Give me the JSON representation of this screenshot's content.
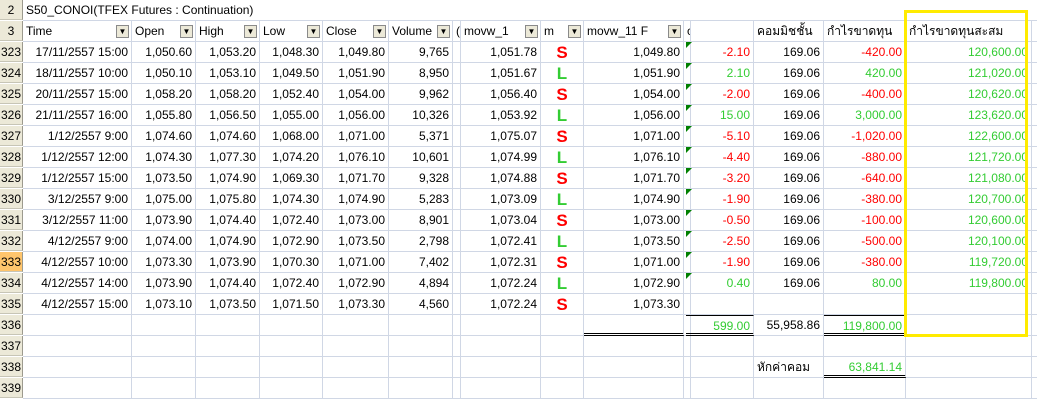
{
  "title_row": {
    "row": "2",
    "text": "S50_CONOI(TFEX Futures : Continuation)"
  },
  "header_row": {
    "row": "3",
    "time": "Time",
    "open": "Open",
    "high": "High",
    "low": "Low",
    "close": "Close",
    "volume": "Volume",
    "g": "(",
    "movw1": "movw_1",
    "m": "m",
    "movw11": "movw_11 F",
    "ce": "ce",
    "commission": "คอมมิชชั้น",
    "profit": "กำไรขาดทุน",
    "cumulative": "กำไรขาดทุนสะสม"
  },
  "rows": [
    {
      "row": "323",
      "time": "17/11/2557 15:00",
      "open": "1,050.60",
      "high": "1,053.20",
      "low": "1,048.30",
      "close": "1,049.80",
      "volume": "9,765",
      "movw": "1,051.78",
      "sig": "S",
      "price": "1,049.80",
      "diff": "-2.10",
      "comm": "169.06",
      "pl": "-420.00",
      "cum": "120,600.00"
    },
    {
      "row": "324",
      "time": "18/11/2557 10:00",
      "open": "1,050.10",
      "high": "1,053.10",
      "low": "1,049.50",
      "close": "1,051.90",
      "volume": "8,950",
      "movw": "1,051.67",
      "sig": "L",
      "price": "1,051.90",
      "diff": "2.10",
      "comm": "169.06",
      "pl": "420.00",
      "cum": "121,020.00"
    },
    {
      "row": "325",
      "time": "20/11/2557 15:00",
      "open": "1,058.20",
      "high": "1,058.20",
      "low": "1,052.40",
      "close": "1,054.00",
      "volume": "9,962",
      "movw": "1,056.40",
      "sig": "S",
      "price": "1,054.00",
      "diff": "-2.00",
      "comm": "169.06",
      "pl": "-400.00",
      "cum": "120,620.00"
    },
    {
      "row": "326",
      "time": "21/11/2557 16:00",
      "open": "1,055.80",
      "high": "1,056.50",
      "low": "1,055.00",
      "close": "1,056.00",
      "volume": "10,326",
      "movw": "1,053.92",
      "sig": "L",
      "price": "1,056.00",
      "diff": "15.00",
      "comm": "169.06",
      "pl": "3,000.00",
      "cum": "123,620.00"
    },
    {
      "row": "327",
      "time": "1/12/2557 9:00",
      "open": "1,074.60",
      "high": "1,074.60",
      "low": "1,068.00",
      "close": "1,071.00",
      "volume": "5,371",
      "movw": "1,075.07",
      "sig": "S",
      "price": "1,071.00",
      "diff": "-5.10",
      "comm": "169.06",
      "pl": "-1,020.00",
      "cum": "122,600.00"
    },
    {
      "row": "328",
      "time": "1/12/2557 12:00",
      "open": "1,074.30",
      "high": "1,077.30",
      "low": "1,074.20",
      "close": "1,076.10",
      "volume": "10,601",
      "movw": "1,074.99",
      "sig": "L",
      "price": "1,076.10",
      "diff": "-4.40",
      "comm": "169.06",
      "pl": "-880.00",
      "cum": "121,720.00"
    },
    {
      "row": "329",
      "time": "1/12/2557 15:00",
      "open": "1,073.50",
      "high": "1,074.90",
      "low": "1,069.30",
      "close": "1,071.70",
      "volume": "9,328",
      "movw": "1,074.88",
      "sig": "S",
      "price": "1,071.70",
      "diff": "-3.20",
      "comm": "169.06",
      "pl": "-640.00",
      "cum": "121,080.00"
    },
    {
      "row": "330",
      "time": "3/12/2557 9:00",
      "open": "1,075.00",
      "high": "1,075.80",
      "low": "1,074.30",
      "close": "1,074.90",
      "volume": "5,283",
      "movw": "1,073.09",
      "sig": "L",
      "price": "1,074.90",
      "diff": "-1.90",
      "comm": "169.06",
      "pl": "-380.00",
      "cum": "120,700.00"
    },
    {
      "row": "331",
      "time": "3/12/2557 11:00",
      "open": "1,073.90",
      "high": "1,074.40",
      "low": "1,072.40",
      "close": "1,073.00",
      "volume": "8,901",
      "movw": "1,073.04",
      "sig": "S",
      "price": "1,073.00",
      "diff": "-0.50",
      "comm": "169.06",
      "pl": "-100.00",
      "cum": "120,600.00"
    },
    {
      "row": "332",
      "time": "4/12/2557 9:00",
      "open": "1,074.00",
      "high": "1,074.90",
      "low": "1,072.90",
      "close": "1,073.50",
      "volume": "2,798",
      "movw": "1,072.41",
      "sig": "L",
      "price": "1,073.50",
      "diff": "-2.50",
      "comm": "169.06",
      "pl": "-500.00",
      "cum": "120,100.00"
    },
    {
      "row": "333",
      "time": "4/12/2557 10:00",
      "open": "1,073.30",
      "high": "1,073.90",
      "low": "1,070.30",
      "close": "1,071.00",
      "volume": "7,402",
      "movw": "1,072.31",
      "sig": "S",
      "price": "1,071.00",
      "diff": "-1.90",
      "comm": "169.06",
      "pl": "-380.00",
      "cum": "119,720.00"
    },
    {
      "row": "334",
      "time": "4/12/2557 14:00",
      "open": "1,073.90",
      "high": "1,074.40",
      "low": "1,072.40",
      "close": "1,072.90",
      "volume": "4,894",
      "movw": "1,072.24",
      "sig": "L",
      "price": "1,072.90",
      "diff": "0.40",
      "comm": "169.06",
      "pl": "80.00",
      "cum": "119,800.00"
    },
    {
      "row": "335",
      "time": "4/12/2557 15:00",
      "open": "1,073.10",
      "high": "1,073.50",
      "low": "1,071.50",
      "close": "1,073.30",
      "volume": "4,560",
      "movw": "1,072.24",
      "sig": "S",
      "price": "1,073.30",
      "diff": "",
      "comm": "",
      "pl": "",
      "cum": ""
    }
  ],
  "totals": {
    "row": "336",
    "diff": "599.00",
    "comm": "55,958.86",
    "pl": "119,800.00"
  },
  "empty_row": {
    "row": "337"
  },
  "net": {
    "row": "338",
    "label": "หักค่าคอม",
    "value": "63,841.14"
  },
  "partial_row": {
    "row": "339"
  },
  "selected_row": "333",
  "colors": {
    "highlight": "#ffeb00",
    "negative": "#ff0000",
    "positive": "#33cc33",
    "selected_header": "#ffc56c"
  }
}
